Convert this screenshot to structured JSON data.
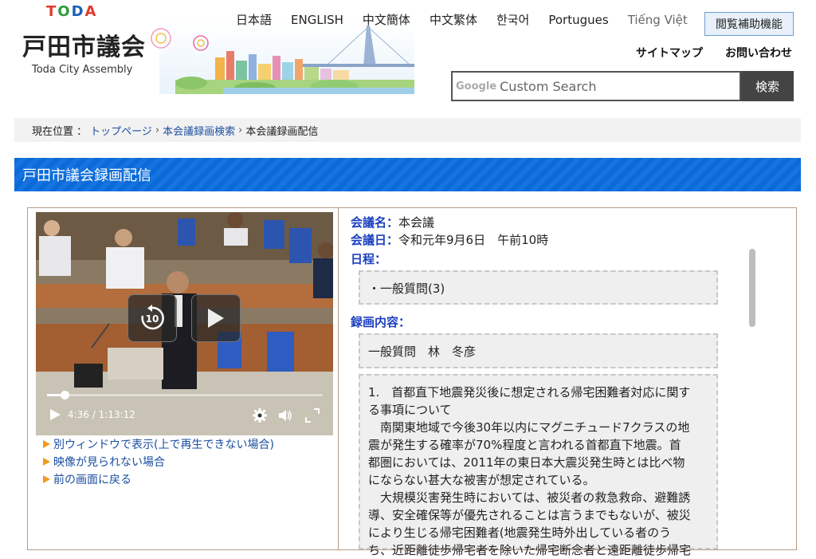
{
  "header": {
    "logo_mark": [
      "T",
      "O",
      "D",
      "A"
    ],
    "logo_title": "戸田市議会",
    "logo_subtitle": "Toda City Assembly",
    "languages": [
      "日本語",
      "ENGLISH",
      "中文簡体",
      "中文繁体",
      "한국어",
      "Portugues",
      "Tiếng Việt"
    ],
    "a11y_button": "閲覧補助機能",
    "util_links": [
      "サイトマップ",
      "お問い合わせ"
    ],
    "search": {
      "google_label": "Google",
      "placeholder": "Custom Search",
      "button": "検索"
    }
  },
  "breadcrumb": {
    "prefix": "現在位置 ：",
    "items": [
      "トップページ",
      "本会議録画検索",
      "本会議録画配信"
    ]
  },
  "page_title": "戸田市議会録画配信",
  "video": {
    "current_time": "4:36",
    "duration": "/ 1:13:12",
    "progress": 0.063
  },
  "links": [
    "別ウィンドウで表示(上で再生できない場合)",
    "映像が見られない場合",
    "前の画面に戻る"
  ],
  "info": {
    "meeting_label": "会議名：",
    "meeting_value": "本会議",
    "date_label": "会議日：",
    "date_value": "令和元年9月6日　午前10時",
    "schedule_label": "日程：",
    "schedule_item": "・一般質問(3)",
    "content_label": "録画内容：",
    "speaker": "一般質問　林　冬彦",
    "content_lines": [
      "1.　首都直下地震発災後に想定される帰宅困難者対応に関す",
      "る事項について",
      "　南関東地域で今後30年以内にマグニチュード7クラスの地",
      "震が発生する確率が70%程度と言われる首都直下地震。首",
      "都圏においては、2011年の東日本大震災発生時とは比べ物",
      "にならない甚大な被害が想定されている。",
      "　大規模災害発生時においては、被災者の救急救命、避難誘",
      "導、安全確保等が優先されることは言うまでもないが、被災",
      "により生じる帰宅困難者(地震発生時外出している者のう",
      "ち、近距離徒歩帰宅者を除いた帰宅断念者と遠距離徒歩帰宅"
    ]
  },
  "colors": {
    "accent_blue": "#0a6ad8",
    "link": "#1a4ea0",
    "label": "#1b3fbf",
    "arrow": "#f39a1e"
  }
}
